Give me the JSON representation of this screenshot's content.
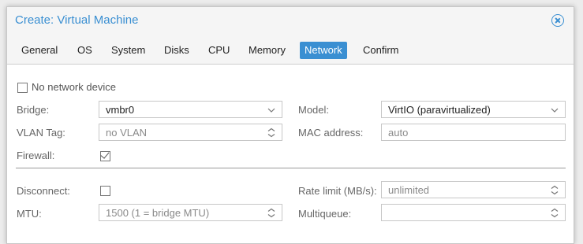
{
  "dialog": {
    "title": "Create: Virtual Machine"
  },
  "tabs": [
    {
      "label": "General"
    },
    {
      "label": "OS"
    },
    {
      "label": "System"
    },
    {
      "label": "Disks"
    },
    {
      "label": "CPU"
    },
    {
      "label": "Memory"
    },
    {
      "label": "Network",
      "active": true
    },
    {
      "label": "Confirm"
    }
  ],
  "form": {
    "no_network_device": {
      "label": "No network device",
      "checked": false
    },
    "bridge": {
      "label": "Bridge:",
      "value": "vmbr0"
    },
    "model": {
      "label": "Model:",
      "value": "VirtIO (paravirtualized)"
    },
    "vlan_tag": {
      "label": "VLAN Tag:",
      "placeholder": "no VLAN"
    },
    "mac_address": {
      "label": "MAC address:",
      "placeholder": "auto"
    },
    "firewall": {
      "label": "Firewall:",
      "checked": true
    },
    "disconnect": {
      "label": "Disconnect:",
      "checked": false
    },
    "rate_limit": {
      "label": "Rate limit (MB/s):",
      "placeholder": "unlimited"
    },
    "mtu": {
      "label": "MTU:",
      "placeholder": "1500 (1 = bridge MTU)"
    },
    "multiqueue": {
      "label": "Multiqueue:",
      "placeholder": ""
    }
  },
  "colors": {
    "accent": "#3a8fd2",
    "label": "#666666",
    "border": "#c7c7c7"
  },
  "icons": {
    "close": "close-circle-icon",
    "dropdown": "chevron-down-icon",
    "spinner": "spinner-arrows-icon",
    "checkbox_checked": "check-icon"
  }
}
